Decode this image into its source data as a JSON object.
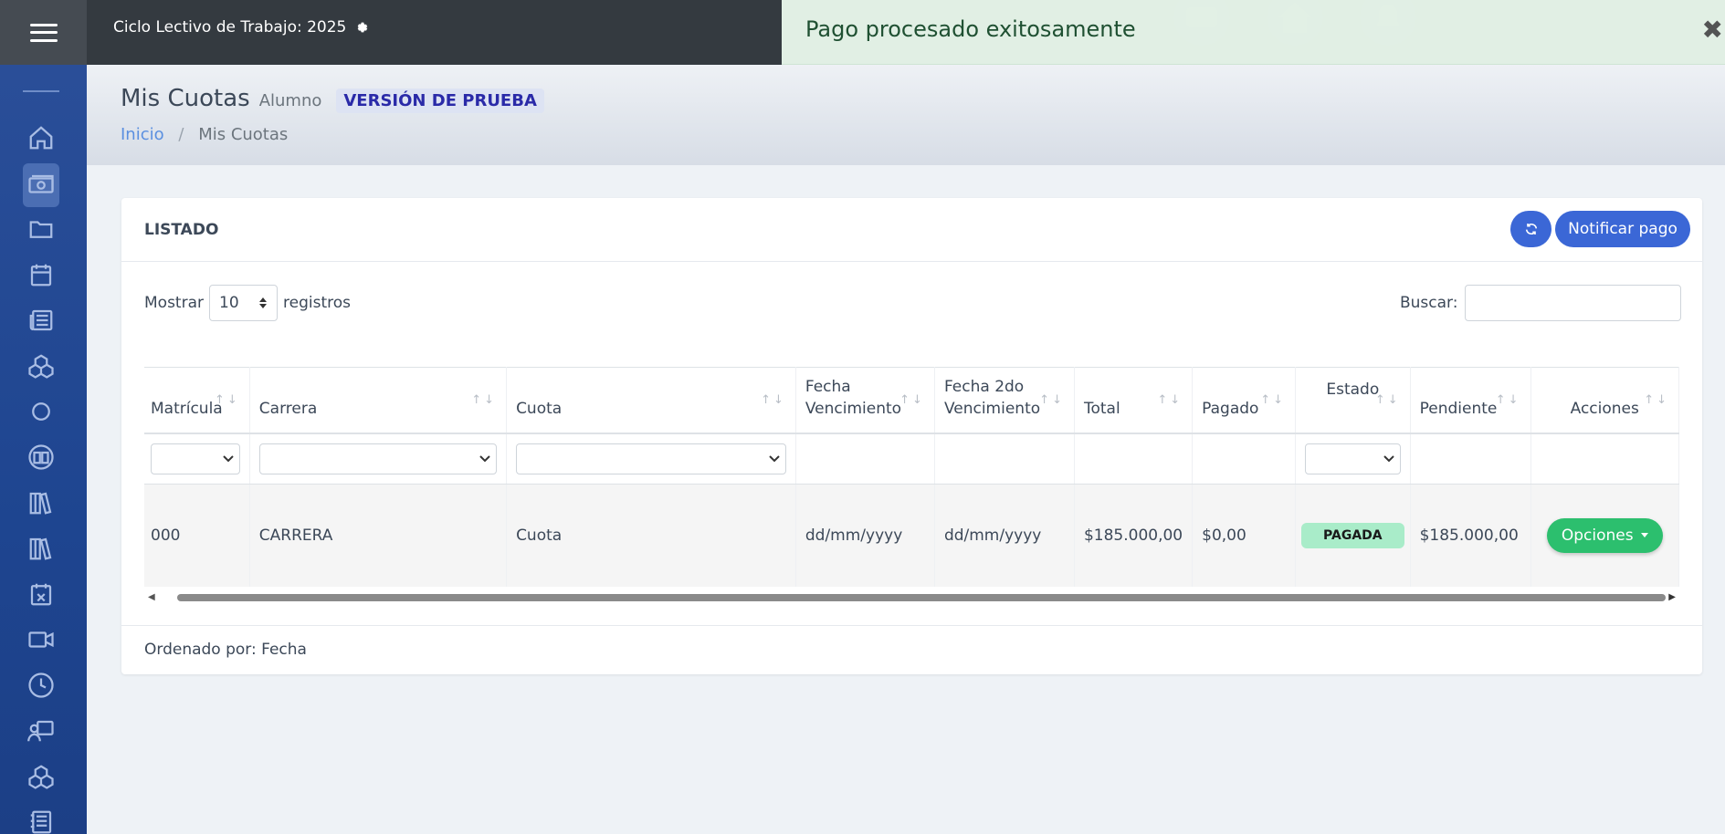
{
  "topbar": {
    "cycle_label": "Ciclo Lectivo de Trabajo: 2025"
  },
  "toast": {
    "message": "Pago procesado exitosamente",
    "close": "✖"
  },
  "sidebar": {
    "items": [
      {
        "icon": "home-icon"
      },
      {
        "icon": "money-icon",
        "active": true
      },
      {
        "icon": "folder-icon"
      },
      {
        "icon": "calendar-icon"
      },
      {
        "icon": "newspaper-icon"
      },
      {
        "icon": "cubes-icon"
      },
      {
        "icon": "circle-icon"
      },
      {
        "icon": "book-open-icon"
      },
      {
        "icon": "books-icon"
      },
      {
        "icon": "books-alt-icon"
      },
      {
        "icon": "calendar-x-icon"
      },
      {
        "icon": "video-icon"
      },
      {
        "icon": "clock-icon"
      },
      {
        "icon": "teacher-icon"
      },
      {
        "icon": "cubes-alt-icon"
      },
      {
        "icon": "notebook-icon"
      }
    ]
  },
  "header": {
    "title": "Mis Cuotas",
    "subtitle": "Alumno",
    "badge": "VERSIÓN DE PRUEBA",
    "breadcrumb_home": "Inicio",
    "breadcrumb_sep": "/",
    "breadcrumb_current": "Mis Cuotas"
  },
  "card": {
    "title": "LISTADO",
    "notify_label": "Notificar pago",
    "show_label": "Mostrar",
    "page_size": "10",
    "records_label": "registros",
    "search_label": "Buscar:",
    "footer": "Ordenado por: Fecha"
  },
  "table": {
    "columns": [
      {
        "line1": "",
        "line2": "Matrícula"
      },
      {
        "line1": "",
        "line2": "Carrera"
      },
      {
        "line1": "",
        "line2": "Cuota"
      },
      {
        "line1": "Fecha",
        "line2": "Vencimiento"
      },
      {
        "line1": "Fecha 2do",
        "line2": "Vencimiento"
      },
      {
        "line1": "",
        "line2": "Total"
      },
      {
        "line1": "",
        "line2": "Pagado"
      },
      {
        "line1": "Estado",
        "line2": ""
      },
      {
        "line1": "",
        "line2": "Pendiente"
      },
      {
        "line1": "",
        "line2": "Acciones"
      }
    ],
    "row": {
      "matricula": "000",
      "carrera": "CARRERA",
      "cuota": "Cuota",
      "fecha_venc": "dd/mm/yyyy",
      "fecha_2do": "dd/mm/yyyy",
      "total": "$185.000,00",
      "pagado": "$0,00",
      "estado": "PAGADA",
      "pendiente": "$185.000,00",
      "acciones": "Opciones"
    }
  },
  "colors": {
    "sidebar": "#1e4590",
    "primary_button": "#3b67d6",
    "success_button": "#2cbf6e",
    "status_badge": "#a9ecc9"
  }
}
